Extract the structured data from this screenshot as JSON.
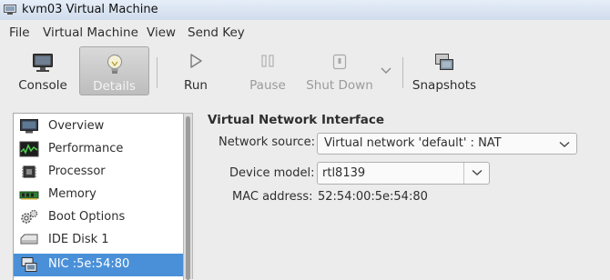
{
  "window": {
    "title": "kvm03 Virtual Machine"
  },
  "menubar": {
    "items": [
      "File",
      "Virtual Machine",
      "View",
      "Send Key"
    ]
  },
  "toolbar": {
    "console": "Console",
    "details": "Details",
    "run": "Run",
    "pause": "Pause",
    "shutdown": "Shut Down",
    "snapshots": "Snapshots"
  },
  "sidebar": {
    "items": [
      {
        "label": "Overview",
        "icon": "monitor-icon"
      },
      {
        "label": "Performance",
        "icon": "performance-graph-icon"
      },
      {
        "label": "Processor",
        "icon": "cpu-chip-icon"
      },
      {
        "label": "Memory",
        "icon": "memory-module-icon"
      },
      {
        "label": "Boot Options",
        "icon": "gears-icon"
      },
      {
        "label": "IDE Disk 1",
        "icon": "disk-drive-icon"
      },
      {
        "label": "NIC :5e:54:80",
        "icon": "network-card-icon",
        "selected": true
      }
    ]
  },
  "details": {
    "heading": "Virtual Network Interface",
    "network_source_label": "Network source:",
    "network_source_value": "Virtual network 'default' : NAT",
    "device_model_label": "Device model:",
    "device_model_value": "rtl8139",
    "mac_label": "MAC address:",
    "mac_value": "52:54:00:5e:54:80"
  },
  "colors": {
    "selection": "#4a90d9",
    "window_bg": "#ececec"
  }
}
